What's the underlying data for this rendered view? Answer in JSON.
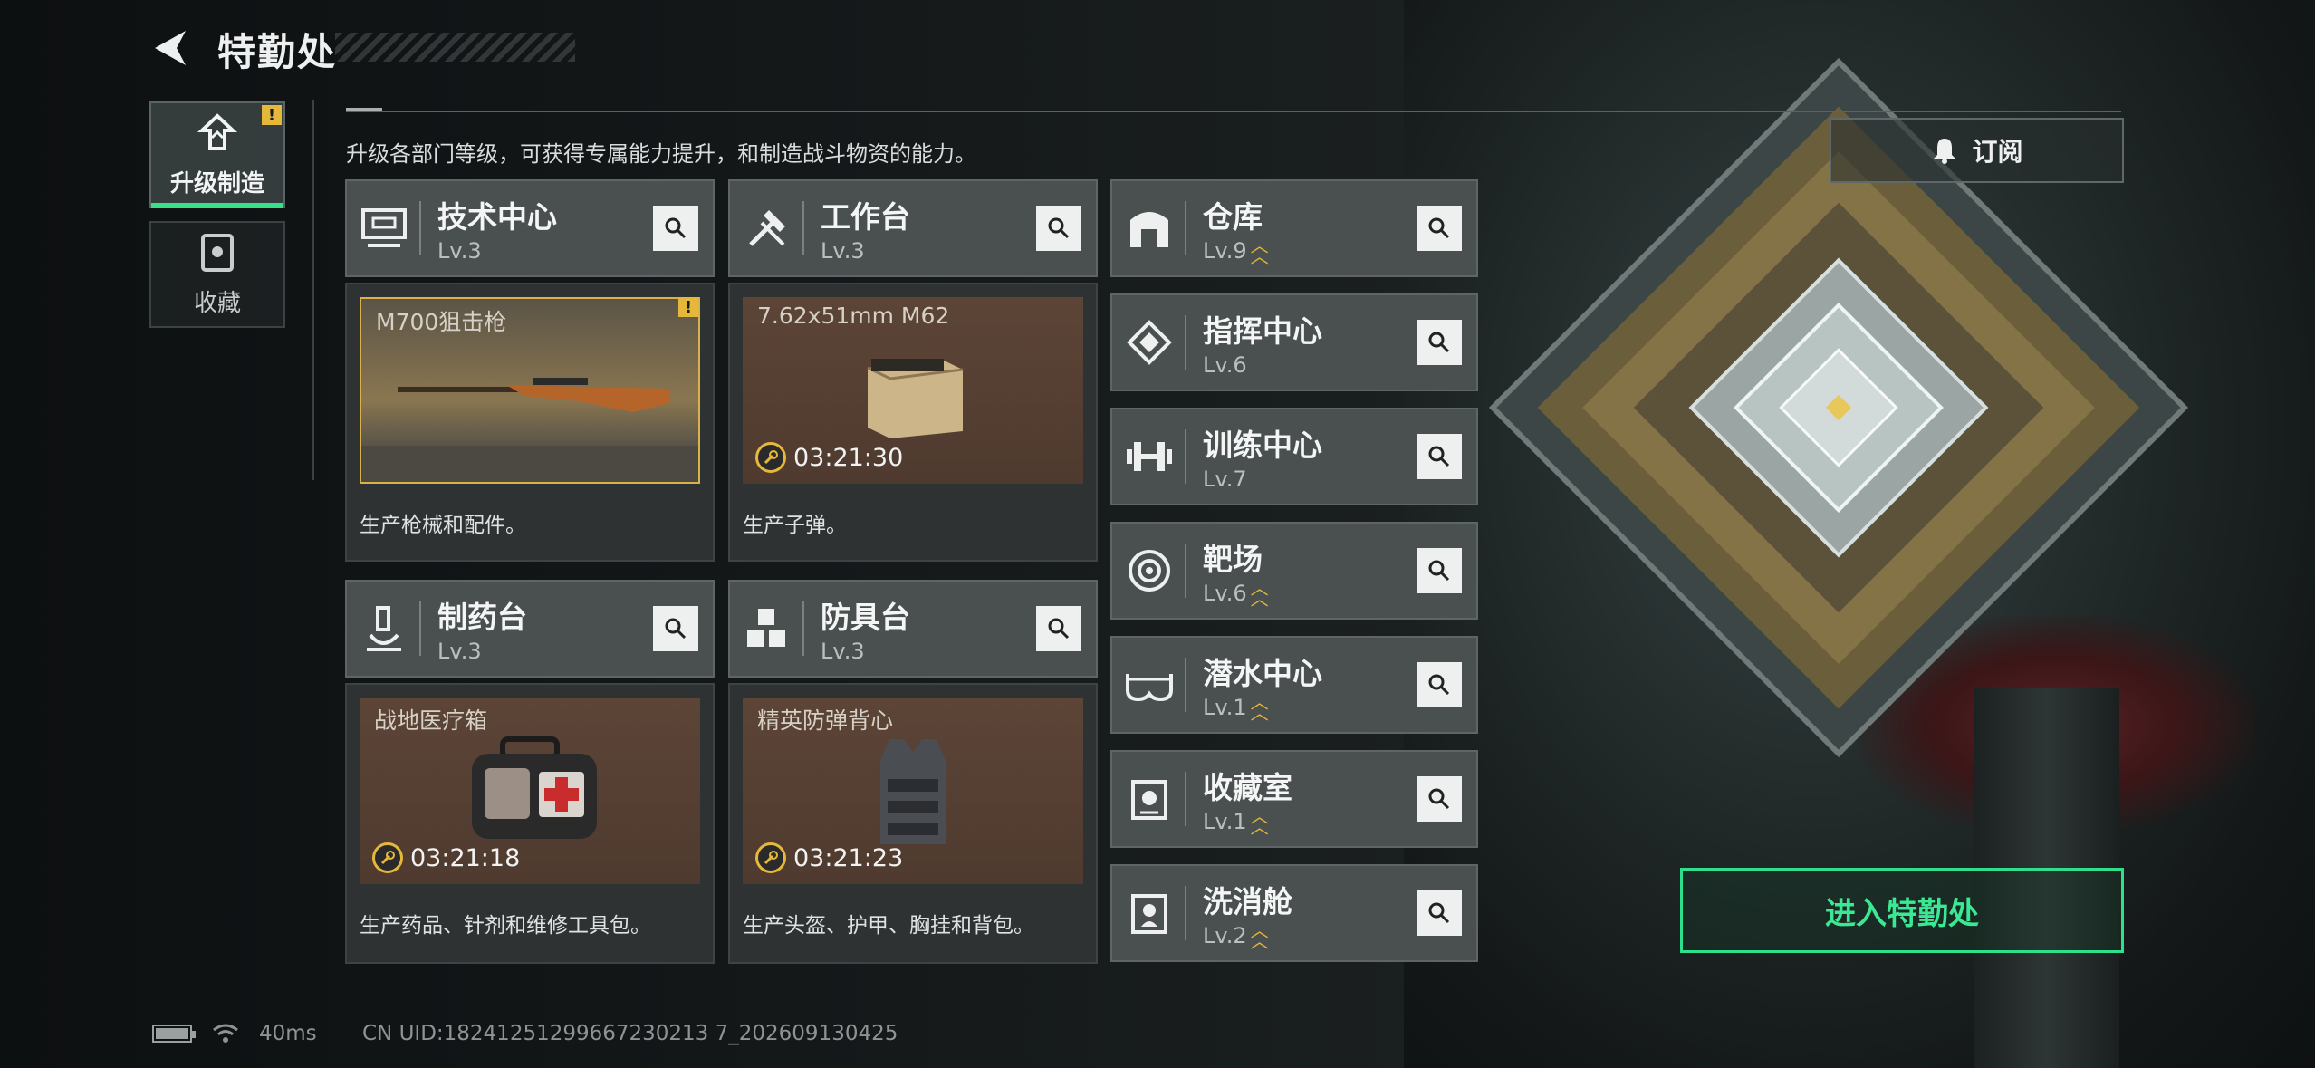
{
  "header": {
    "title": "特勤处"
  },
  "subtitle": "升级各部门等级，可获得专属能力提升，和制造战斗物资的能力。",
  "side_nav": [
    {
      "label": "升级制造",
      "active": true,
      "icon": "upgrade-icon",
      "badge": "!"
    },
    {
      "label": "收藏",
      "active": false,
      "icon": "collection-icon"
    }
  ],
  "production_departments": [
    {
      "name": "技术中心",
      "level": "Lv.3",
      "icon": "computer-icon",
      "item": "M700狙击枪",
      "timer": "",
      "description": "生产枪械和配件。",
      "badge": "!"
    },
    {
      "name": "工作台",
      "level": "Lv.3",
      "icon": "tools-icon",
      "item": "7.62x51mm M62",
      "timer": "03:21:30",
      "description": "生产子弹。"
    },
    {
      "name": "制药台",
      "level": "Lv.3",
      "icon": "microscope-icon",
      "item": "战地医疗箱",
      "timer": "03:21:18",
      "description": "生产药品、针剂和维修工具包。"
    },
    {
      "name": "防具台",
      "level": "Lv.3",
      "icon": "cubes-icon",
      "item": "精英防弹背心",
      "timer": "03:21:23",
      "description": "生产头盔、护甲、胸挂和背包。"
    }
  ],
  "facilities": [
    {
      "name": "仓库",
      "level": "Lv.9",
      "upgradable": true,
      "icon": "warehouse-icon"
    },
    {
      "name": "指挥中心",
      "level": "Lv.6",
      "upgradable": false,
      "icon": "command-icon"
    },
    {
      "name": "训练中心",
      "level": "Lv.7",
      "upgradable": false,
      "icon": "dumbbell-icon"
    },
    {
      "name": "靶场",
      "level": "Lv.6",
      "upgradable": true,
      "icon": "target-icon"
    },
    {
      "name": "潜水中心",
      "level": "Lv.1",
      "upgradable": true,
      "icon": "diving-mask-icon"
    },
    {
      "name": "收藏室",
      "level": "Lv.1",
      "upgradable": true,
      "icon": "collection-room-icon"
    },
    {
      "name": "洗消舱",
      "level": "Lv.2",
      "upgradable": true,
      "icon": "decon-icon"
    }
  ],
  "subscribe_label": "订阅",
  "enter_label": "进入特勤处",
  "status": {
    "ping": "40ms",
    "uid": "CN UID:18241251299667230213 7_202609130425"
  },
  "colors": {
    "accent_green": "#2ee08c",
    "upgrade_gold": "#e6b83a",
    "card_bg": "#4a4f50"
  }
}
